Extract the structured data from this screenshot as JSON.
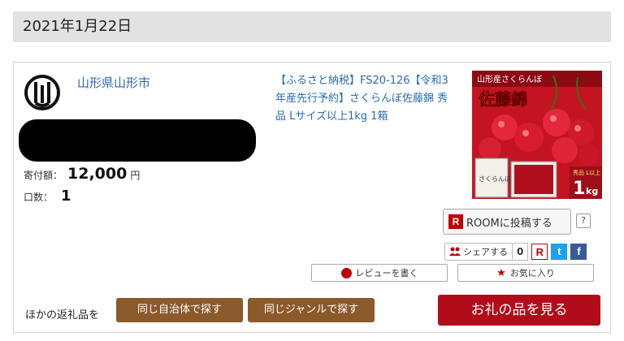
{
  "date": "2021年1月22日",
  "municipality": {
    "name": "山形県山形市"
  },
  "donation": {
    "amount_label": "寄付額：",
    "amount_value": "12,000",
    "amount_unit": "円",
    "count_label": "口数：",
    "count_value": "1"
  },
  "product": {
    "title": "【ふるさと納税】FS20-126【令和3年産先行予約】さくらんぼ佐藤錦 秀品 Lサイズ以上1kg 1箱",
    "image": {
      "banner_text": "山形産さくらんぼ",
      "title_text": "佐藤錦",
      "box_text": "さくらんぼ",
      "grade_text": "秀品 L以上",
      "weight_value": "1",
      "weight_unit": "kg"
    }
  },
  "actions": {
    "room_badge": "R",
    "room_label": "ROOMに投稿する",
    "help_label": "?",
    "share_label": "シェアする",
    "share_count": "0",
    "rakuten_icon": "R",
    "twitter_icon": "t",
    "facebook_icon": "f",
    "review_label": "レビューを書く",
    "favorite_label": "お気に入り"
  },
  "footer": {
    "other_label": "ほかの返礼品を",
    "same_muni_label": "同じ自治体で探す",
    "same_genre_label": "同じジャンルで探す",
    "view_label": "お礼の品を見る"
  },
  "colors": {
    "link": "#2a6ab3",
    "brown": "#8b5a2b",
    "red": "#b20c1b"
  }
}
